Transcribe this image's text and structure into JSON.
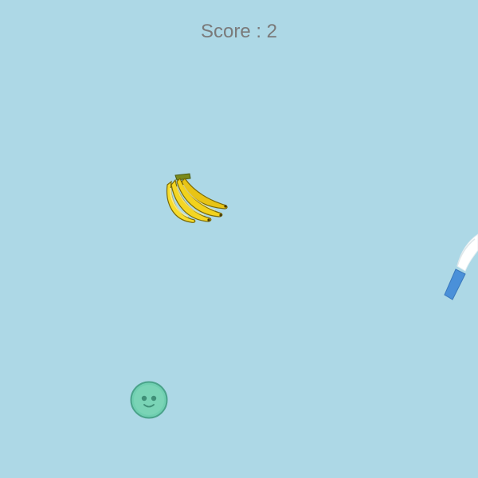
{
  "hud": {
    "score_label": "Score : ",
    "score_value": "2"
  },
  "objects": {
    "fruit": "banana-icon",
    "blade": "knife-icon",
    "player": "smiley-ball-icon"
  },
  "colors": {
    "background": "#add8e6",
    "score_text": "#7a7a7a",
    "banana_yellow": "#f2d21c",
    "banana_shadow": "#c9a40a",
    "knife_handle": "#4a90d9",
    "knife_blade": "#ffffff",
    "player_fill": "#6fcfb0",
    "player_stroke": "#3f9e84"
  }
}
